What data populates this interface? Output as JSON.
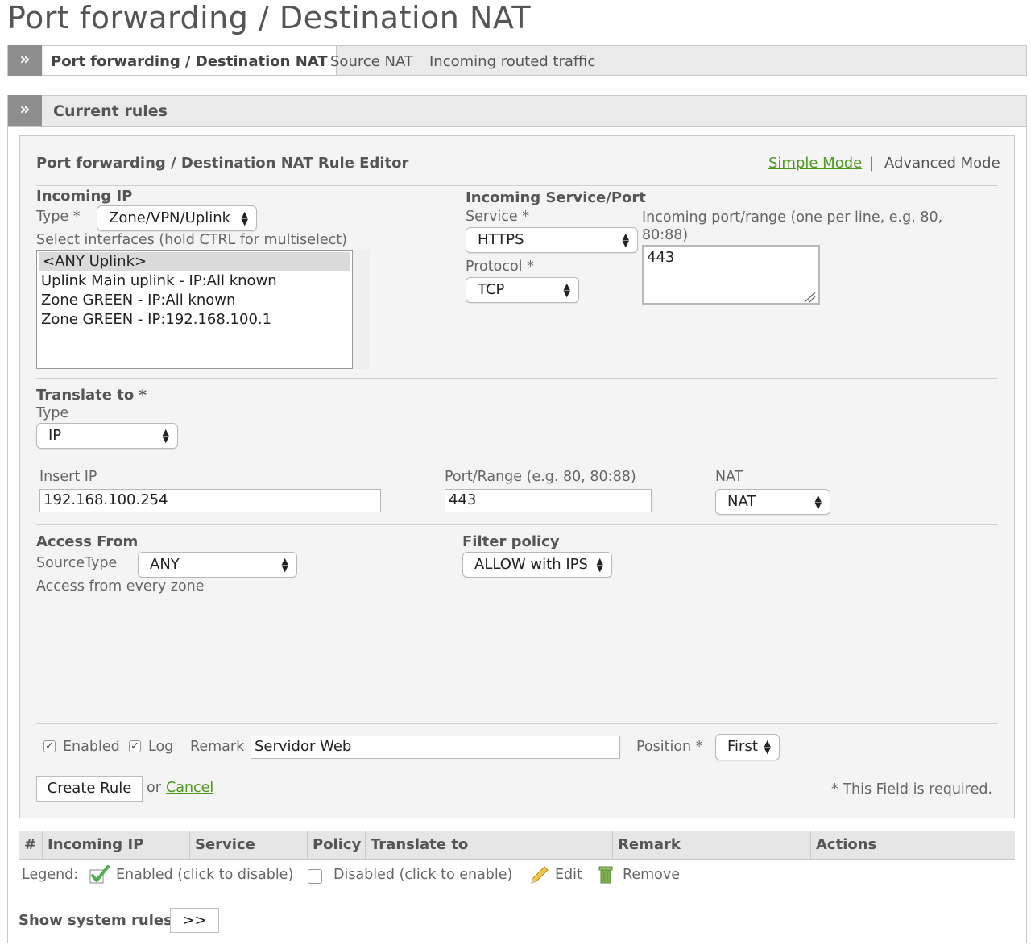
{
  "page": {
    "title": "Port forwarding / Destination NAT"
  },
  "tabs": [
    {
      "label": "Port forwarding / Destination NAT",
      "active": true
    },
    {
      "label": "Source NAT"
    },
    {
      "label": "Incoming routed traffic"
    }
  ],
  "section": {
    "title": "Current rules",
    "chevron": "»"
  },
  "editor": {
    "title": "Port forwarding / Destination NAT Rule Editor",
    "simple_mode": "Simple Mode",
    "separator": "|",
    "advanced_mode": "Advanced Mode",
    "incoming_ip": {
      "header": "Incoming IP",
      "type_label": "Type *",
      "type_value": "Zone/VPN/Uplink",
      "interfaces_label": "Select interfaces (hold CTRL for multiselect)",
      "interfaces": [
        "<ANY Uplink>",
        "Uplink Main uplink - IP:All known",
        "Zone GREEN - IP:All known",
        "Zone GREEN - IP:192.168.100.1"
      ]
    },
    "incoming_service": {
      "header": "Incoming Service/Port",
      "service_label": "Service *",
      "service_value": "HTTPS",
      "protocol_label": "Protocol *",
      "protocol_value": "TCP",
      "port_label": "Incoming port/range (one per line, e.g. 80, 80:88)",
      "port_value": "443"
    },
    "translate": {
      "header": "Translate to *",
      "type_label": "Type",
      "type_value": "IP",
      "ip_label": "Insert IP",
      "ip_value": "192.168.100.254",
      "port_label": "Port/Range (e.g. 80, 80:88)",
      "port_value": "443",
      "nat_label": "NAT",
      "nat_value": "NAT"
    },
    "access": {
      "header": "Access From",
      "source_label": "SourceType",
      "source_value": "ANY",
      "note": "Access from every zone"
    },
    "filter": {
      "header": "Filter policy",
      "value": "ALLOW with IPS"
    },
    "footer": {
      "enabled_label": "Enabled",
      "log_label": "Log",
      "remark_label": "Remark",
      "remark_value": "Servidor Web",
      "position_label": "Position *",
      "position_value": "First",
      "create_button": "Create Rule",
      "or_text": "or",
      "cancel": "Cancel",
      "required_note": "* This Field is required."
    }
  },
  "table": {
    "columns": [
      "#",
      "Incoming IP",
      "Service",
      "Policy",
      "Translate to",
      "Remark",
      "Actions"
    ]
  },
  "legend": {
    "label": "Legend:",
    "enabled": "Enabled (click to disable)",
    "disabled": "Disabled (click to enable)",
    "edit": "Edit",
    "remove": "Remove"
  },
  "system_rules": {
    "label": "Show system rules",
    "button": ">>"
  },
  "icons": {
    "checkmark": "check-icon",
    "pencil": "pencil-icon",
    "trash": "trash-icon"
  },
  "colors": {
    "link": "#4d9a1e",
    "chevron_bg": "#8e8e8e"
  }
}
